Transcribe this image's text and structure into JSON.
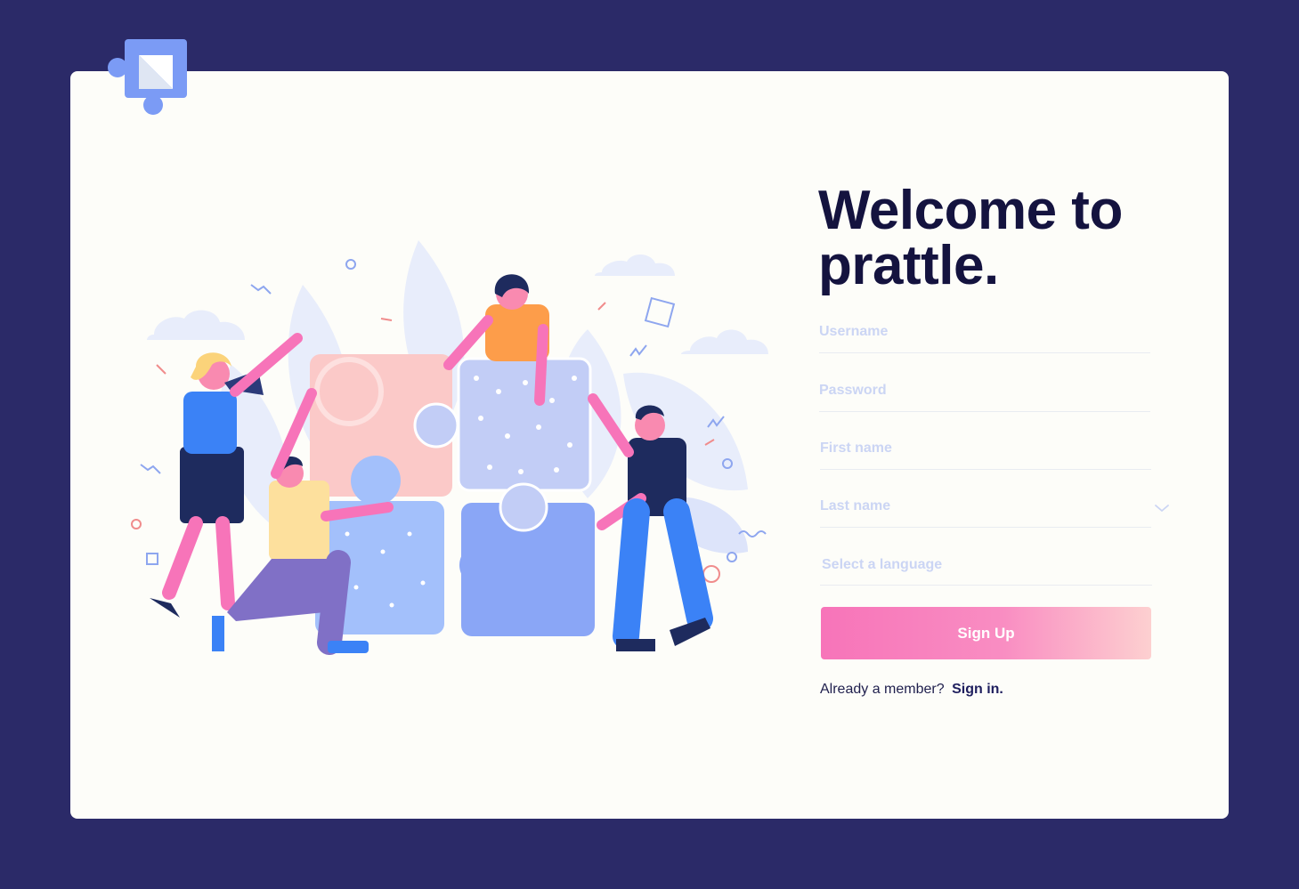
{
  "welcome": {
    "line1": "Welcome to",
    "line2": "prattle."
  },
  "form": {
    "username_placeholder": "Username",
    "password_placeholder": "Password",
    "first_name_placeholder": "First name",
    "last_name_placeholder": "Last name",
    "language_placeholder": "Select a language",
    "submit_label": "Sign Up"
  },
  "footer": {
    "prompt": "Already a member?",
    "link": "Sign in."
  },
  "colors": {
    "background": "#2b2a68",
    "card": "#fdfdf9",
    "title": "#14133f",
    "button_gradient_start": "#f774b9",
    "button_gradient_end": "#fdd0d0",
    "placeholder": "#cbd5f4"
  },
  "icons": {
    "logo": "puzzle-logo-icon",
    "dropdown": "chevron-down-icon"
  }
}
